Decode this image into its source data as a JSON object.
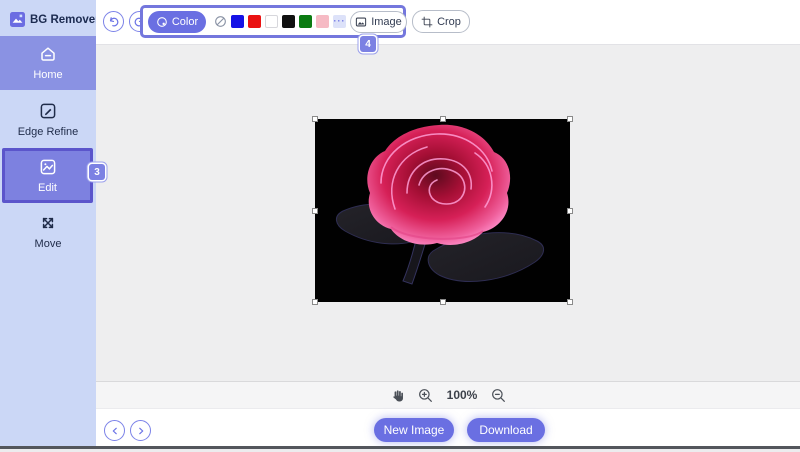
{
  "app": {
    "name": "BG Remover"
  },
  "sidebar": {
    "brand": "BG Remover",
    "items": [
      {
        "label": "Home",
        "active": true
      },
      {
        "label": "Edge Refine"
      },
      {
        "label": "Edit",
        "highlighted": true,
        "badge": "3"
      },
      {
        "label": "Move"
      }
    ]
  },
  "toolbar": {
    "color_label": "Color",
    "image_label": "Image",
    "crop_label": "Crop",
    "step_badge": "4",
    "swatches": [
      {
        "name": "transparent-none",
        "color": ""
      },
      {
        "name": "blue",
        "color": "#1512e6"
      },
      {
        "name": "red",
        "color": "#ea1212"
      },
      {
        "name": "white",
        "color": "#ffffff"
      },
      {
        "name": "black",
        "color": "#101010"
      },
      {
        "name": "green",
        "color": "#0b7b12"
      },
      {
        "name": "pink",
        "color": "#f6bac4"
      },
      {
        "name": "more",
        "color": "#dde2f9",
        "label": "···"
      }
    ]
  },
  "canvas": {
    "zoom_level": "100%"
  },
  "footer": {
    "new_image_label": "New Image",
    "download_label": "Download"
  },
  "icons": {
    "logo": "purple-image-logo",
    "home": "house",
    "edge_refine": "pen-square",
    "edit": "image-frame",
    "move": "cross-arrows",
    "undo": "curved-arrow-left",
    "redo": "curved-arrow-right",
    "color": "palette",
    "none_swatch": "slashed-circle",
    "image": "picture",
    "crop": "crop-corners",
    "pan": "hand",
    "zoom_in": "magnifier-plus",
    "zoom_out": "magnifier-minus",
    "prev": "chevron-left-circle",
    "next": "chevron-right-circle"
  },
  "colors": {
    "accent": "#6a6fe2",
    "tutorial_highlight": "#5b55cb",
    "sidebar_bg": "#cbd7f6",
    "active_item_bg": "#8a92e3",
    "canvas_bg": "#eeeeef"
  }
}
